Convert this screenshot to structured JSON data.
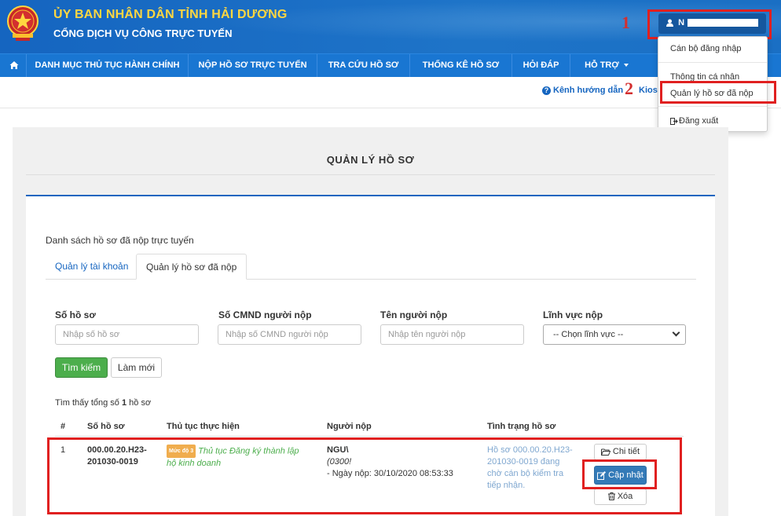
{
  "header": {
    "title": "ỦY BAN NHÂN DÂN TỈNH HẢI DƯƠNG",
    "subtitle": "CỔNG DỊCH VỤ CÔNG TRỰC TUYẾN",
    "user_initial": "N",
    "brand_color": "#1a6fc4",
    "title_color": "#ffd740"
  },
  "annotations": {
    "step1": "1",
    "step2": "2"
  },
  "nav": {
    "home_icon": "home-icon",
    "items": [
      "DANH MỤC THỦ TỤC HÀNH CHÍNH",
      "NỘP HỒ SƠ TRỰC TUYẾN",
      "TRA CỨU HỒ SƠ",
      "THỐNG KÊ HỒ SƠ",
      "HỎI ĐÁP",
      "HỖ TRỢ"
    ]
  },
  "subbar": {
    "guide_link": "Kênh hướng dẫn",
    "kios_link": "Kios"
  },
  "user_menu": {
    "items": [
      "Cán bộ đăng nhập",
      "Thông tin cá nhân",
      "Quản lý hồ sơ đã nộp",
      "Đăng xuất"
    ]
  },
  "page": {
    "title": "QUẢN LÝ HỒ SƠ",
    "list_caption": "Danh sách hồ sơ đã nộp trực tuyến",
    "tabs": [
      "Quản lý tài khoản",
      "Quản lý hồ sơ đã nộp"
    ]
  },
  "filters": {
    "so_ho_so": {
      "label": "Số hồ sơ",
      "placeholder": "Nhập số hồ sơ"
    },
    "cmnd": {
      "label": "Số CMND người nộp",
      "placeholder": "Nhập số CMND người nộp"
    },
    "ten": {
      "label": "Tên người nộp",
      "placeholder": "Nhập tên người nộp"
    },
    "linh_vuc": {
      "label": "Lĩnh vực nộp",
      "selected": "-- Chọn lĩnh vực --"
    },
    "search_button": "Tìm kiếm",
    "reset_button": "Làm mới"
  },
  "results": {
    "count_prefix": "Tìm thấy tổng số ",
    "count": "1",
    "count_suffix": " hồ sơ"
  },
  "table": {
    "headers": [
      "#",
      "Số hồ sơ",
      "Thủ tục thực hiện",
      "Người nộp",
      "Tình trạng hồ sơ"
    ],
    "rows": [
      {
        "index": "1",
        "so_ho_so_line1": "000.00.20.H23-",
        "so_ho_so_line2": "201030-0019",
        "level": "Mức độ 3",
        "procedure_line1": "Thủ tục Đăng ký thành lập",
        "procedure_line2": "hộ kinh doanh",
        "submitter_name": "NGU\\",
        "submitter_id": "(0300!",
        "submit_date": "- Ngày nộp: 30/10/2020 08:53:33",
        "status_line1": "Hồ sơ 000.00.20.H23-",
        "status_line2": "201030-0019 đang",
        "status_line3": "chờ cán bộ kiểm tra",
        "status_line4": "tiếp nhận.",
        "actions": {
          "detail": "Chi tiết",
          "update": "Cập nhật",
          "delete": "Xóa"
        }
      }
    ]
  }
}
